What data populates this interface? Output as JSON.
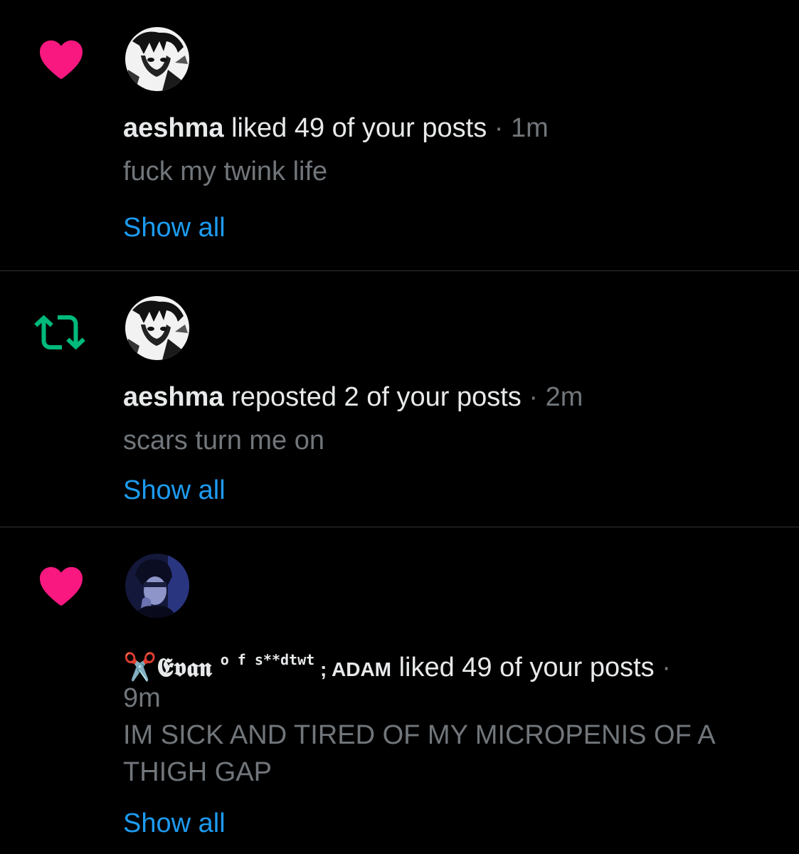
{
  "colors": {
    "background": "#000000",
    "like_pink": "#f91880",
    "repost_green": "#00ba7c",
    "link_blue": "#1d9bf0",
    "text_primary": "#e7e9ea",
    "text_secondary": "#71767b",
    "divider": "#2f3336"
  },
  "notifications": [
    {
      "type": "like",
      "icon": "heart-icon",
      "user_name": "aeshma",
      "action_text": " liked 49 of your posts",
      "separator": " · ",
      "time": "1m",
      "snippet": "fuck my twink life",
      "show_all": "Show all"
    },
    {
      "type": "repost",
      "icon": "repost-icon",
      "user_name": "aeshma",
      "action_text": " reposted 2 of your posts",
      "separator": " · ",
      "time": "2m",
      "snippet": "scars turn me on",
      "show_all": "Show all"
    },
    {
      "type": "like",
      "icon": "heart-icon",
      "user_name_emoji": "✂️",
      "user_name_fancy": "𝕰𝖛𝖆𝖓",
      "user_name_sup": " o f ",
      "user_name_sup2": "s**dtwt",
      "user_name_tail": " ; ADAM",
      "action_text": " liked 49 of your posts",
      "separator": " ·",
      "time": "9m",
      "snippet": "IM SICK AND TIRED OF MY MICROPENIS OF A THIGH GAP",
      "show_all": "Show all"
    }
  ]
}
